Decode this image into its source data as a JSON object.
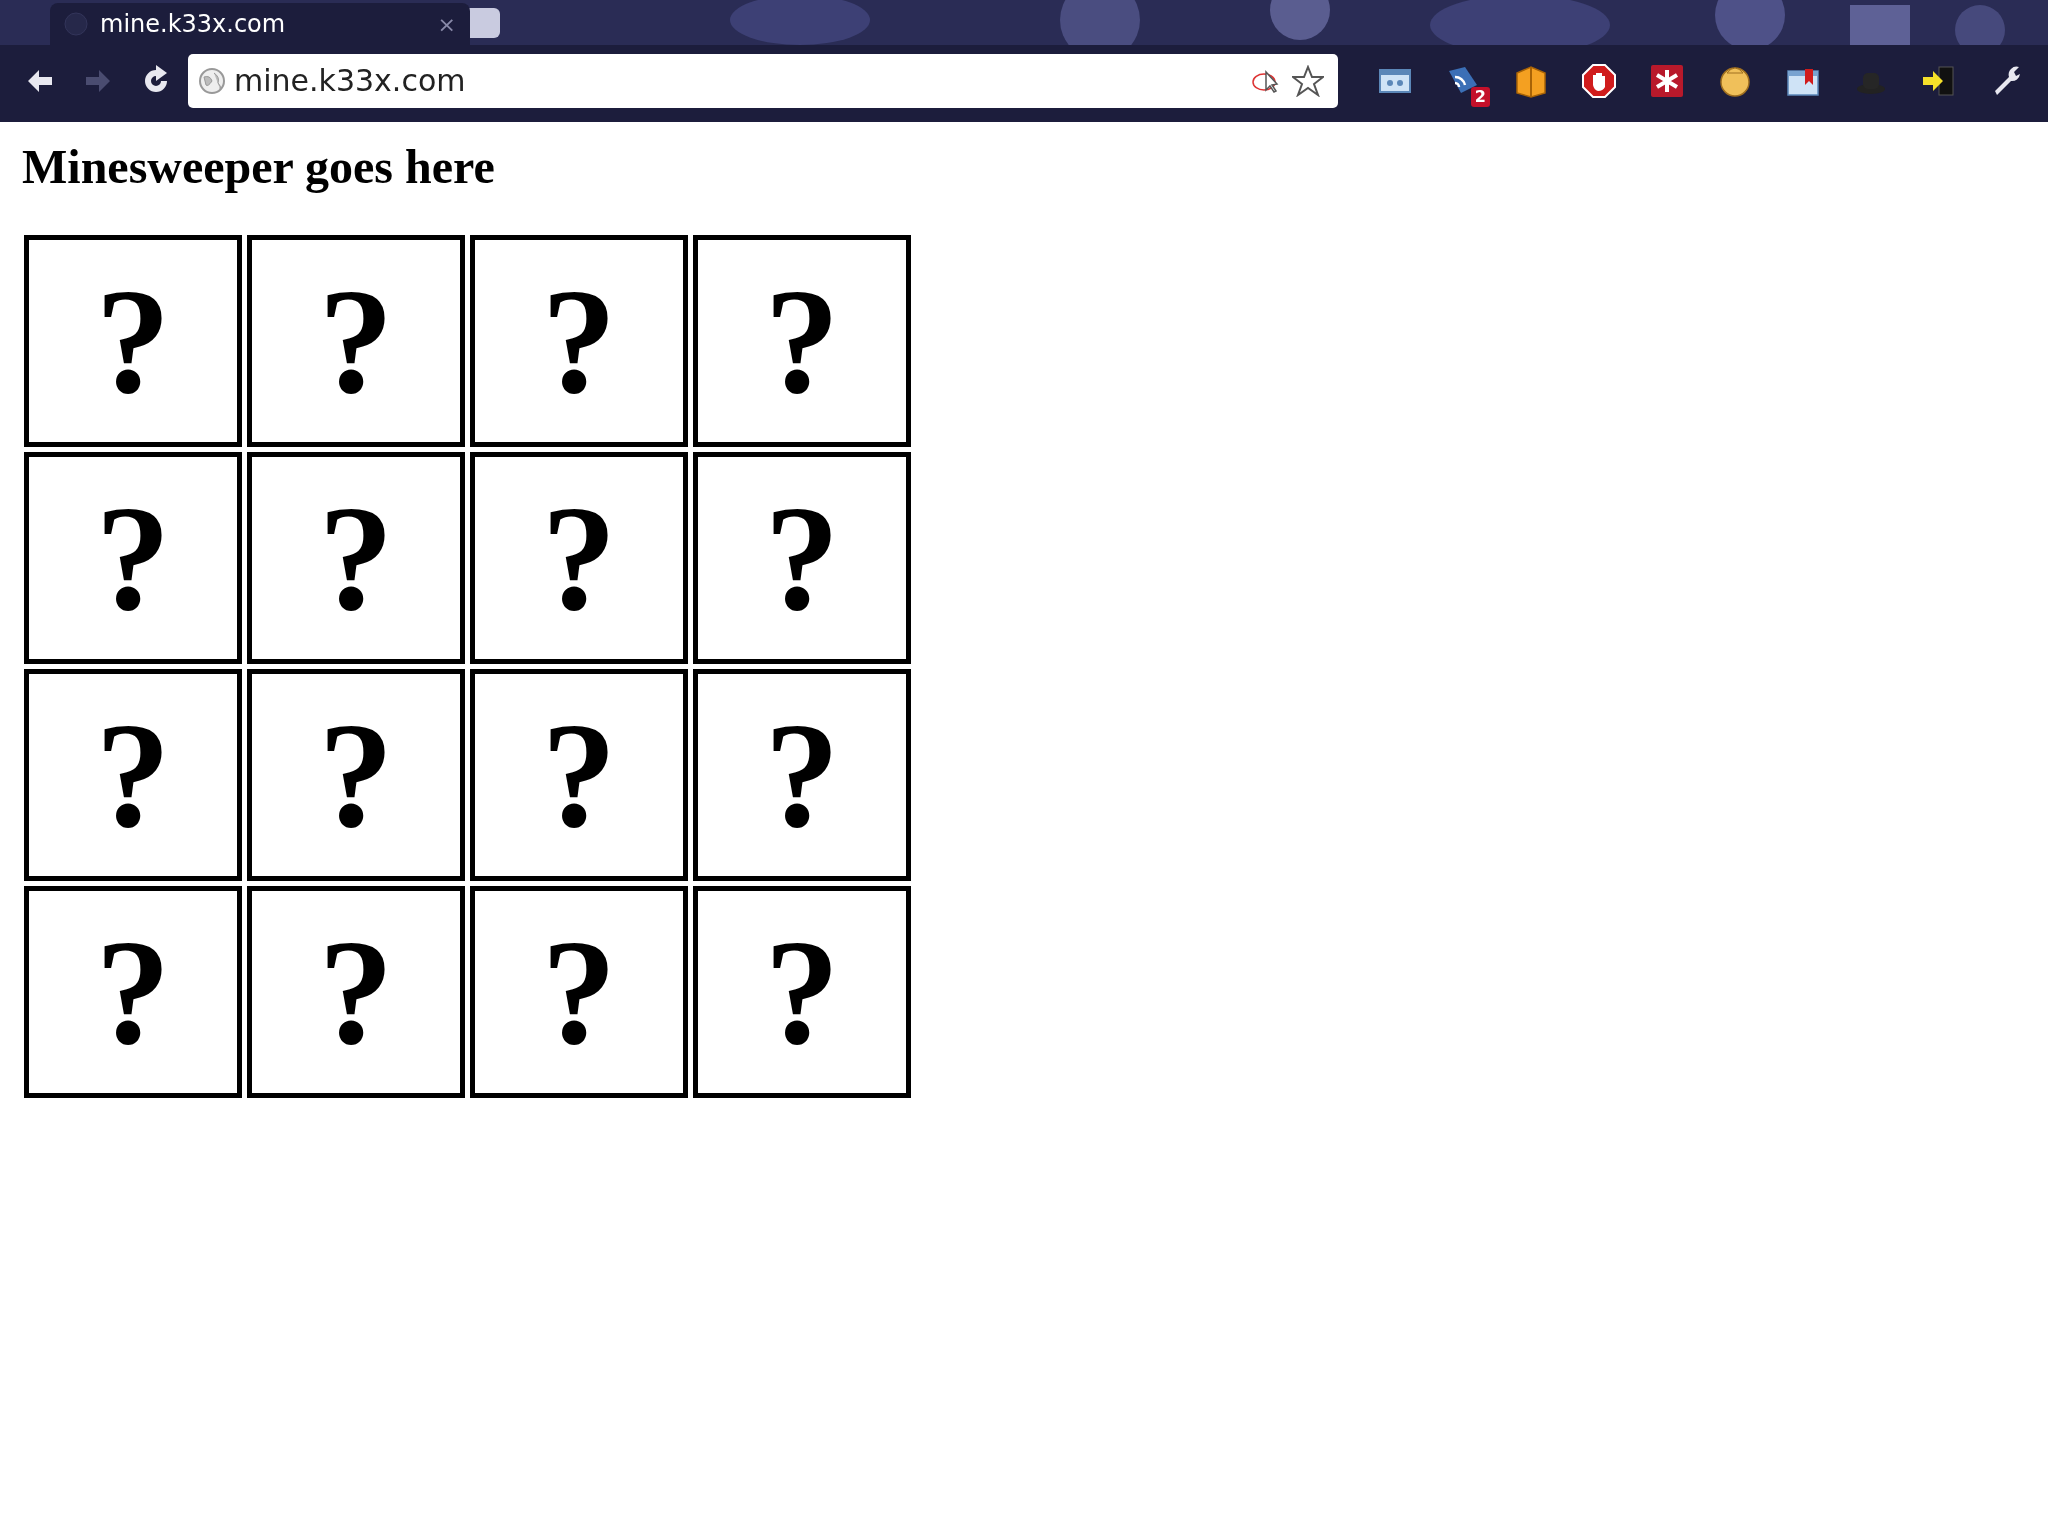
{
  "tab": {
    "title": "mine.k33x.com",
    "close": "×"
  },
  "nav_buttons": [
    {
      "kind": "back",
      "disabled": false
    },
    {
      "kind": "forward",
      "disabled": true
    },
    {
      "kind": "reload",
      "disabled": false
    }
  ],
  "address": {
    "value": "mine.k33x.com"
  },
  "extensions": [
    {
      "kind": "window"
    },
    {
      "kind": "feed",
      "badge": "2"
    },
    {
      "kind": "box"
    },
    {
      "kind": "stop"
    },
    {
      "kind": "asterisk"
    },
    {
      "kind": "face"
    },
    {
      "kind": "bookmark"
    },
    {
      "kind": "hat"
    },
    {
      "kind": "exit"
    },
    {
      "kind": "wrench"
    }
  ],
  "page": {
    "heading": "Minesweeper goes here",
    "board": [
      [
        "?",
        "?",
        "?",
        "?"
      ],
      [
        "?",
        "?",
        "?",
        "?"
      ],
      [
        "?",
        "?",
        "?",
        "?"
      ],
      [
        "?",
        "?",
        "?",
        "?"
      ]
    ]
  }
}
